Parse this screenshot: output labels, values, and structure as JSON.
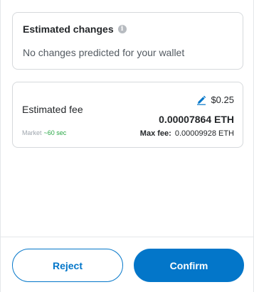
{
  "estimated_changes": {
    "title": "Estimated changes",
    "info_icon": "info-icon",
    "message": "No changes predicted for your wallet"
  },
  "fee": {
    "label": "Estimated fee",
    "usd": "$0.25",
    "edit_icon": "pencil-icon",
    "eth": "0.00007864 ETH",
    "market_label": "Market",
    "market_time": "~60 sec",
    "max_fee_label": "Max fee:",
    "max_fee_value": "0.00009928 ETH"
  },
  "actions": {
    "reject": "Reject",
    "confirm": "Confirm"
  },
  "colors": {
    "primary": "#0376c9",
    "success": "#28a745",
    "muted": "#9fa6ae"
  }
}
